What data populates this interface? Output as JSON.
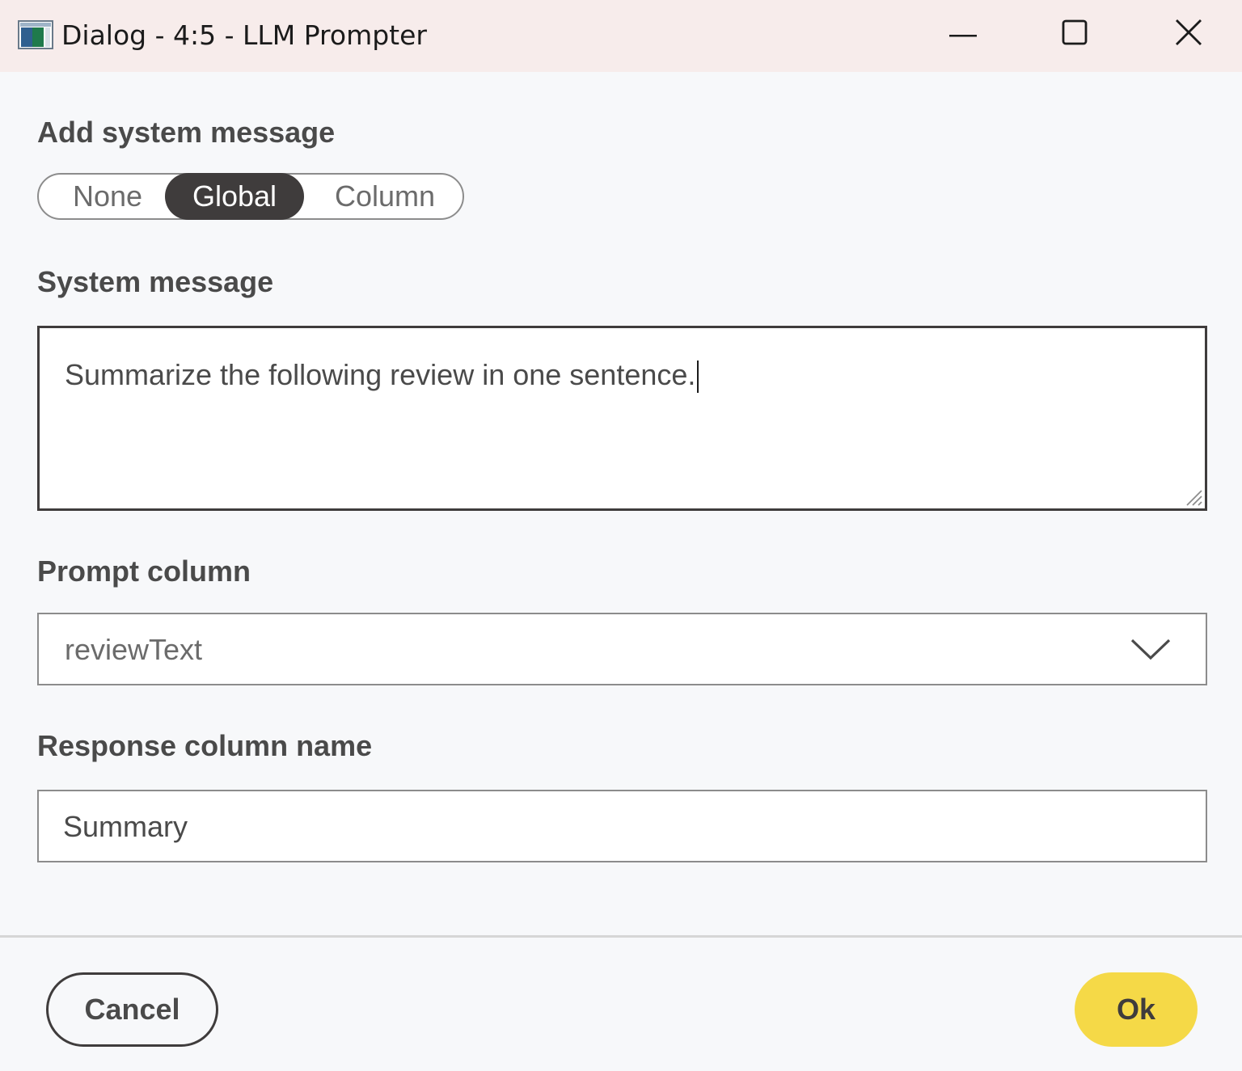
{
  "window": {
    "title": "Dialog - 4:5 - LLM Prompter",
    "icon": "app-window-icon",
    "controls": [
      "minimize-icon",
      "maximize-icon",
      "close-icon"
    ]
  },
  "system_message_mode": {
    "label": "Add system message",
    "options": [
      "None",
      "Global",
      "Column"
    ],
    "selected": "Global"
  },
  "system_message": {
    "label": "System message",
    "value": "Summarize the following review in one sentence."
  },
  "prompt_column": {
    "label": "Prompt column",
    "selected": "reviewText"
  },
  "response_column": {
    "label": "Response column name",
    "value": "Summary"
  },
  "footer": {
    "cancel_label": "Cancel",
    "ok_label": "Ok"
  },
  "colors": {
    "titlebar": "#f7eceb",
    "background": "#f7f8fa",
    "selected_segment": "#3f3c3c",
    "ok_button": "#f5d947"
  }
}
